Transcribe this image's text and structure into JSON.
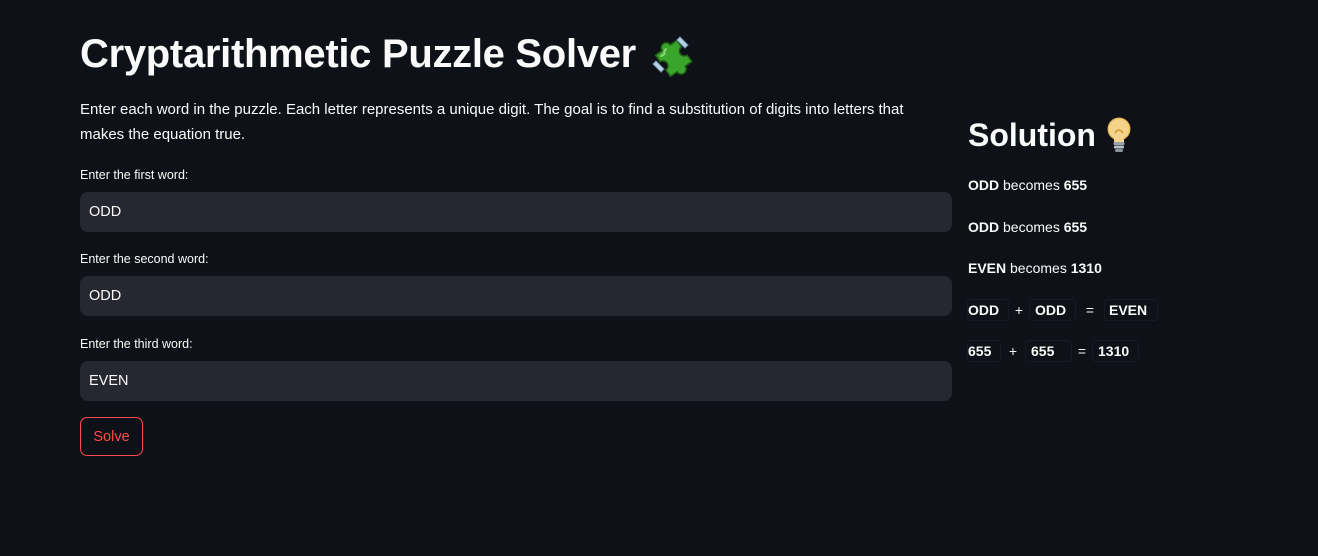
{
  "header": {
    "title": "Cryptarithmetic Puzzle Solver",
    "title_icon": "puzzle-piece-icon"
  },
  "intro": {
    "text": "Enter each word in the puzzle. Each letter represents a unique digit. The goal is to find a substitution of digits into letters that makes the equation true."
  },
  "form": {
    "first": {
      "label": "Enter the first word:",
      "value": "ODD"
    },
    "second": {
      "label": "Enter the second word:",
      "value": "ODD"
    },
    "third": {
      "label": "Enter the third word:",
      "value": "EVEN"
    },
    "solve_label": "Solve"
  },
  "solution": {
    "title": "Solution",
    "title_icon": "lightbulb-icon",
    "becomes_word": "becomes",
    "lines": [
      {
        "word": "ODD",
        "digits": "655"
      },
      {
        "word": "ODD",
        "digits": "655"
      },
      {
        "word": "EVEN",
        "digits": "1310"
      }
    ],
    "word_equation": {
      "a": "ODD",
      "plus": "+",
      "b": "ODD",
      "equals": "=",
      "c": "EVEN"
    },
    "digit_equation": {
      "a": "655",
      "plus": "+",
      "b": "655",
      "equals": "=",
      "c": "1310"
    }
  },
  "colors": {
    "background": "#0e1117",
    "input_bg": "#262730",
    "accent": "#ff4b4b",
    "text": "#fafafa"
  }
}
